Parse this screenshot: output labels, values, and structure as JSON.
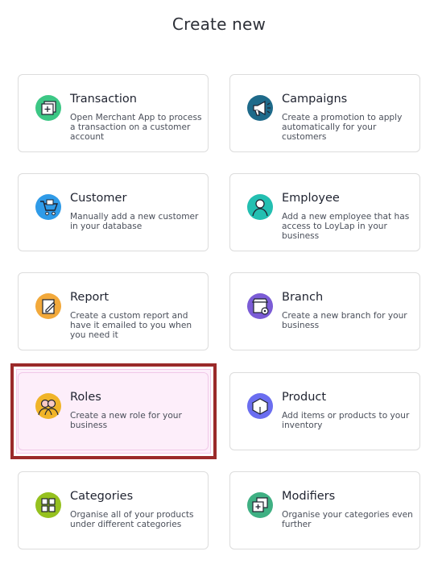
{
  "header": {
    "title": "Create new"
  },
  "cards": [
    {
      "title": "Transaction",
      "desc": "Open Merchant App to process a transaction on a customer account",
      "icon": "transaction-icon",
      "color": "#3cc785"
    },
    {
      "title": "Campaigns",
      "desc": "Create a promotion to apply automatically for your customers",
      "icon": "megaphone-icon",
      "color": "#1e6a8a"
    },
    {
      "title": "Customer",
      "desc": "Manually add a new customer in your database",
      "icon": "shopping-cart-icon",
      "color": "#2f9be8"
    },
    {
      "title": "Employee",
      "desc": "Add a new employee that has access to LoyLap in your business",
      "icon": "employee-icon",
      "color": "#23bfb1"
    },
    {
      "title": "Report",
      "desc": "Create a custom report and have it emailed to you when you need it",
      "icon": "report-icon",
      "color": "#f2a93b"
    },
    {
      "title": "Branch",
      "desc": "Create a new branch for your business",
      "icon": "storefront-icon",
      "color": "#7b5cd6"
    },
    {
      "title": "Roles",
      "desc": "Create a new role for your business",
      "icon": "roles-icon",
      "color": "#f0b429"
    },
    {
      "title": "Product",
      "desc": "Add items or products to your inventory",
      "icon": "box-icon",
      "color": "#6b6ef0"
    },
    {
      "title": "Categories",
      "desc": "Organise all of your products under different categories",
      "icon": "categories-icon",
      "color": "#95c11f"
    },
    {
      "title": "Modifiers",
      "desc": "Organise your categories even further",
      "icon": "modifiers-icon",
      "color": "#3fb083"
    }
  ]
}
